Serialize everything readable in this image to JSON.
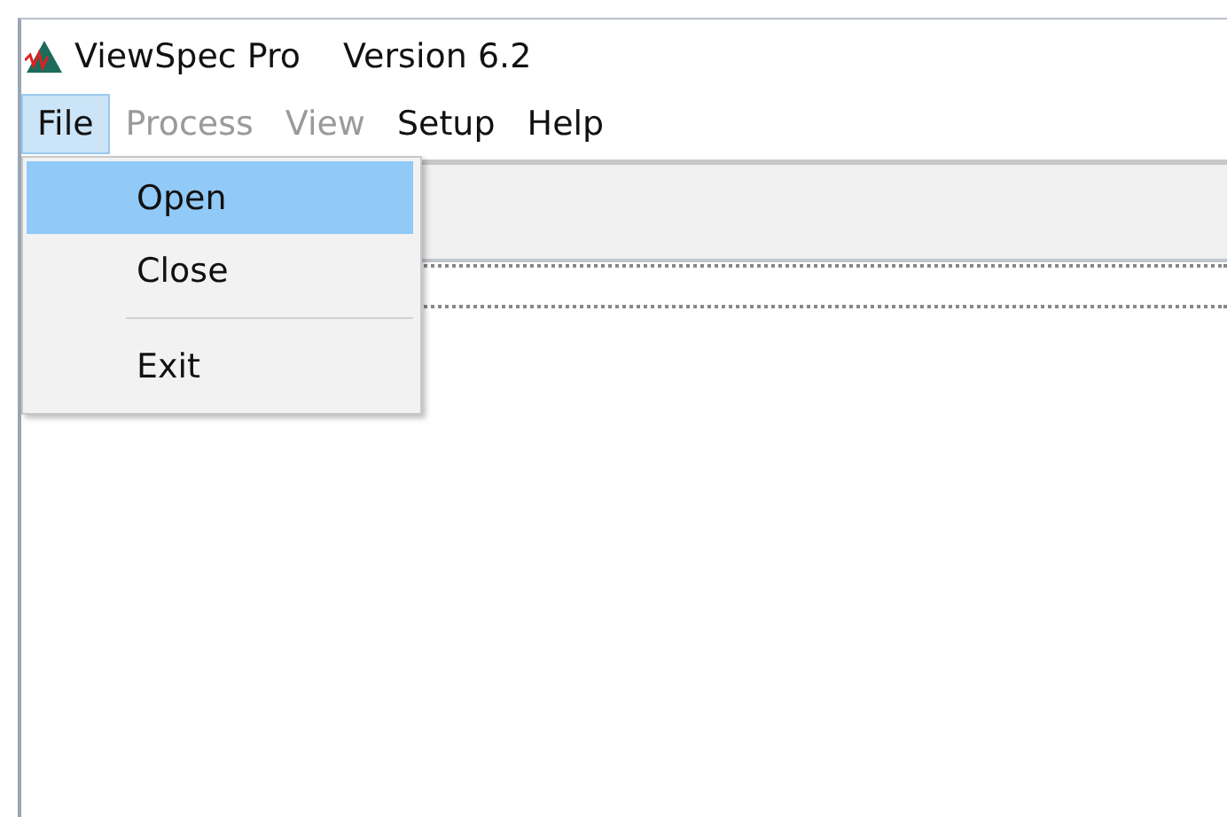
{
  "window": {
    "title": "ViewSpec Pro",
    "version": "Version 6.2"
  },
  "menu_bar": [
    {
      "label": "File",
      "selected": true,
      "disabled": false
    },
    {
      "label": "Process",
      "selected": false,
      "disabled": true
    },
    {
      "label": "View",
      "selected": false,
      "disabled": true
    },
    {
      "label": "Setup",
      "selected": false,
      "disabled": false
    },
    {
      "label": "Help",
      "selected": false,
      "disabled": false
    }
  ],
  "file_menu": [
    {
      "kind": "item",
      "label": "Open",
      "selected": true
    },
    {
      "kind": "item",
      "label": "Close",
      "selected": false
    },
    {
      "kind": "separator"
    },
    {
      "kind": "item",
      "label": "Exit",
      "selected": false
    }
  ]
}
